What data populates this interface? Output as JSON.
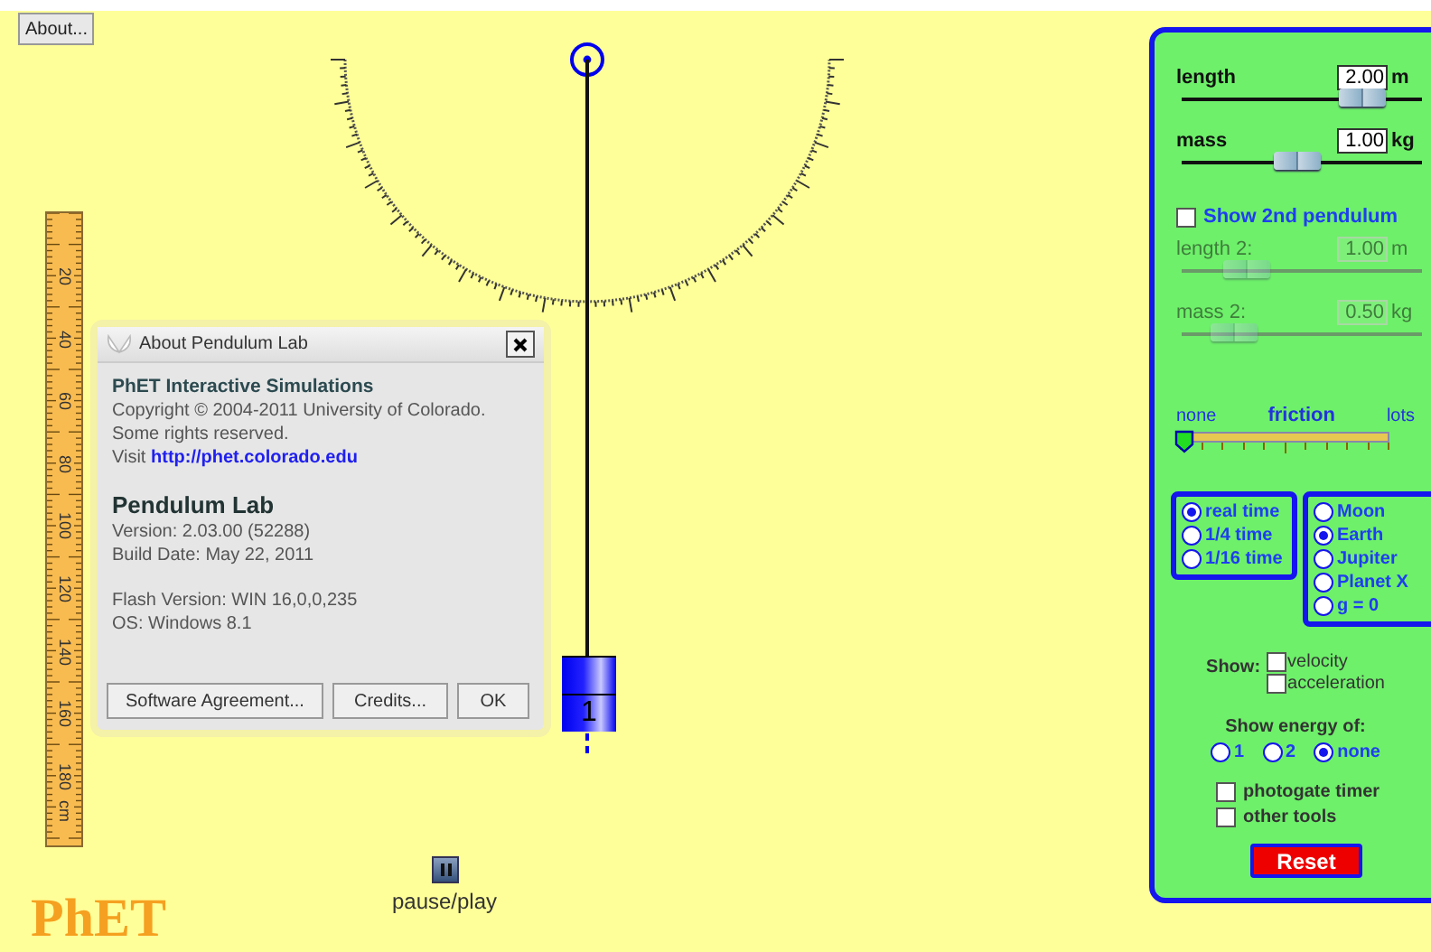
{
  "about_button": {
    "label": "About..."
  },
  "ruler": {
    "labels": [
      "20",
      "40",
      "60",
      "80",
      "100",
      "120",
      "140",
      "160",
      "180"
    ],
    "unit": "cm"
  },
  "pendulum": {
    "bob_label": "1"
  },
  "pause_play": {
    "label": "pause/play"
  },
  "logo": {
    "text": "PhET"
  },
  "about_dialog": {
    "title": "About Pendulum Lab",
    "org": "PhET Interactive Simulations",
    "copyright": "Copyright © 2004-2011 University of Colorado.",
    "rights": "Some rights reserved.",
    "visit_prefix": "Visit",
    "link": "http://phet.colorado.edu",
    "app_name": "Pendulum Lab",
    "version": "Version: 2.03.00 (52288)",
    "build_date": "Build Date: May 22, 2011",
    "flash_version": "Flash Version: WIN 16,0,0,235",
    "os": "OS: Windows 8.1",
    "buttons": [
      "Software Agreement...",
      "Credits...",
      "OK"
    ]
  },
  "controls": {
    "sliders": [
      {
        "label": "length",
        "value": "2.00",
        "unit": "m",
        "level": 0.75,
        "disabled": false
      },
      {
        "label": "mass",
        "value": "1.00",
        "unit": "kg",
        "level": 0.48,
        "disabled": false
      }
    ],
    "second_pendulum": {
      "label": "Show 2nd pendulum",
      "checked": false
    },
    "sliders_2": [
      {
        "label": "length 2:",
        "value": "1.00",
        "unit": "m",
        "level": 0.27,
        "disabled": true
      },
      {
        "label": "mass 2:",
        "value": "0.50",
        "unit": "kg",
        "level": 0.22,
        "disabled": true
      }
    ],
    "friction": {
      "title": "friction",
      "min_label": "none",
      "max_label": "lots",
      "level": 0
    },
    "time_scales": [
      {
        "label": "real time",
        "selected": true
      },
      {
        "label": "1/4 time",
        "selected": false
      },
      {
        "label": "1/16 time",
        "selected": false
      }
    ],
    "gravity": [
      {
        "label": "Moon",
        "selected": false
      },
      {
        "label": "Earth",
        "selected": true
      },
      {
        "label": "Jupiter",
        "selected": false
      },
      {
        "label": "Planet X",
        "selected": false
      },
      {
        "label": "g = 0",
        "selected": false
      }
    ],
    "show": {
      "label": "Show:",
      "options": [
        {
          "label": "velocity",
          "checked": false
        },
        {
          "label": "acceleration",
          "checked": false
        }
      ]
    },
    "energy": {
      "label": "Show energy of:",
      "options": [
        {
          "label": "1",
          "selected": false
        },
        {
          "label": "2",
          "selected": false
        },
        {
          "label": "none",
          "selected": true
        }
      ]
    },
    "tools": [
      {
        "label": "photogate timer",
        "checked": false
      },
      {
        "label": "other tools",
        "checked": false
      }
    ],
    "reset": {
      "label": "Reset"
    }
  }
}
